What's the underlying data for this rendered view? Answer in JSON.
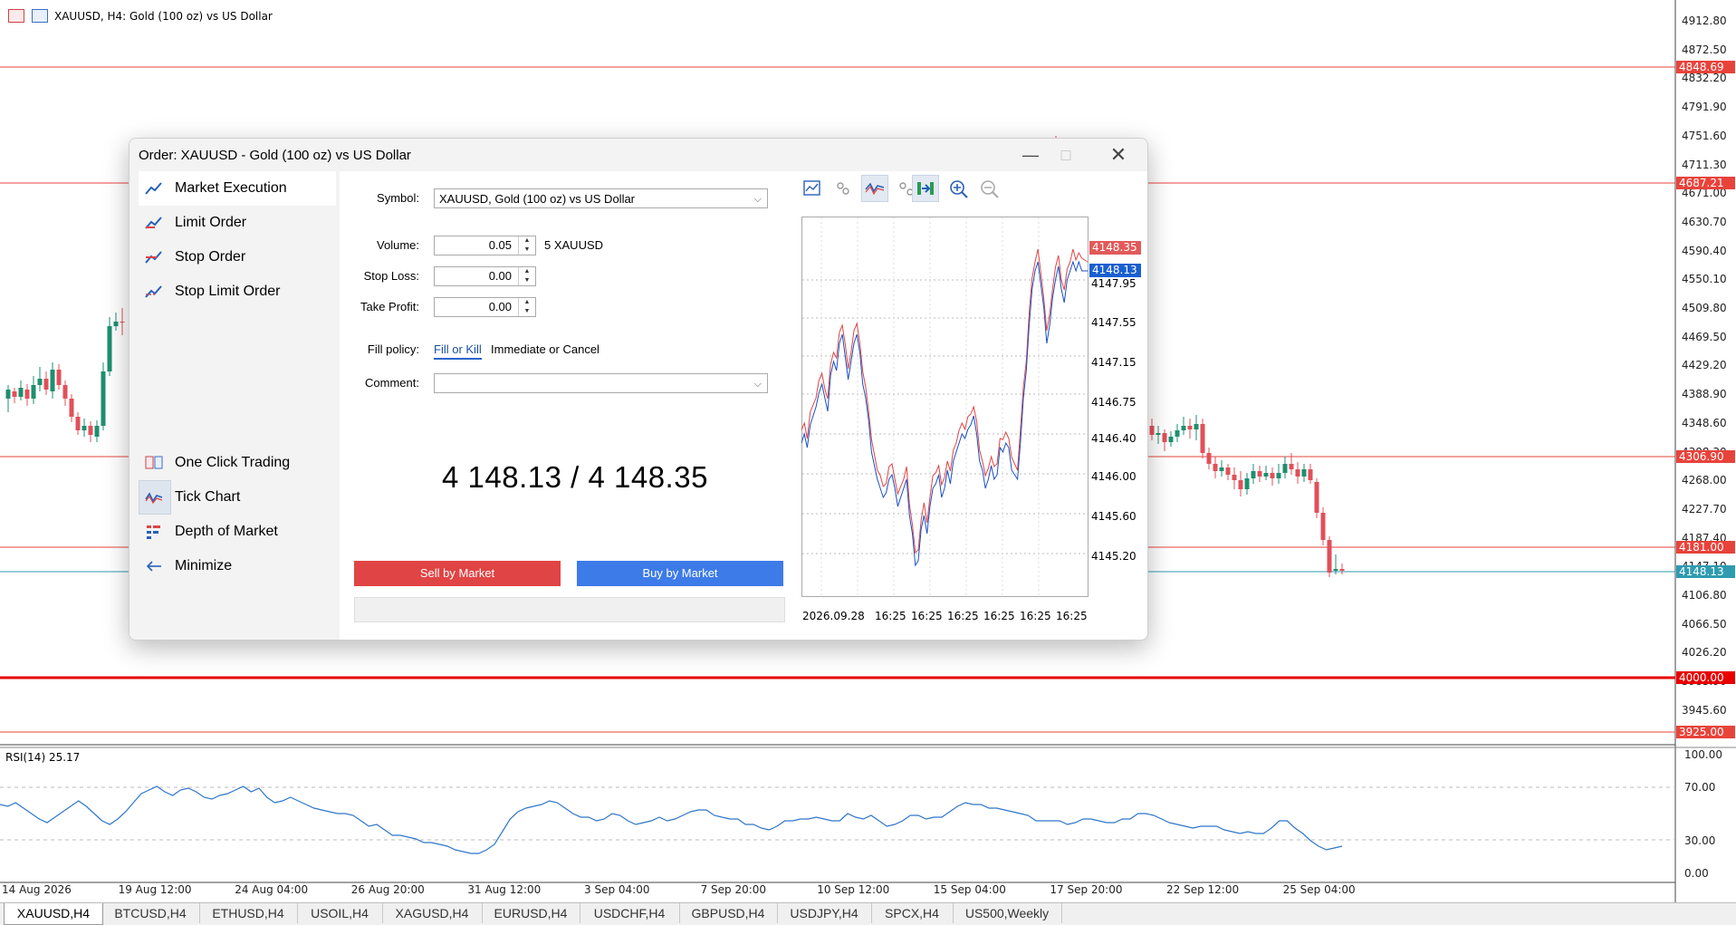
{
  "chart": {
    "title": "XAUUSD, H4:  Gold (100 oz) vs US Dollar",
    "price_ticks": [
      "4912.80",
      "4872.50",
      "4832.20",
      "4791.90",
      "4751.60",
      "4711.30",
      "4671.00",
      "4630.70",
      "4590.40",
      "4550.10",
      "4509.80",
      "4469.50",
      "4429.20",
      "4388.90",
      "4348.60",
      "4308.30",
      "4268.00",
      "4227.70",
      "4187.40",
      "4147.10",
      "4106.80",
      "4066.50",
      "4026.20",
      "3985.90",
      "3945.60"
    ],
    "levels": [
      {
        "price": "4848.69",
        "color": "#e8433b"
      },
      {
        "price": "4687.21",
        "color": "#e8433b"
      },
      {
        "price": "4306.90",
        "color": "#e8433b"
      },
      {
        "price": "4181.00",
        "color": "#e8433b"
      },
      {
        "price": "4148.13",
        "color": "#2e9bb0"
      },
      {
        "price": "4000.00",
        "color": "#e80000"
      },
      {
        "price": "3925.00",
        "color": "#e8433b"
      }
    ],
    "rsi_label": "RSI(14) 25.17",
    "rsi_ticks": [
      "100.00",
      "70.00",
      "30.00",
      "0.00"
    ],
    "time_ticks": [
      "14 Aug 2026",
      "19 Aug 12:00",
      "24 Aug 04:00",
      "26 Aug 20:00",
      "31 Aug 12:00",
      "3 Sep 04:00",
      "7 Sep 20:00",
      "10 Sep 12:00",
      "15 Sep 04:00",
      "17 Sep 20:00",
      "22 Sep 12:00",
      "25 Sep 04:00"
    ],
    "up_color": "#1e8f6f",
    "down_color": "#e0505a"
  },
  "tabs": [
    "XAUUSD,H4",
    "BTCUSD,H4",
    "ETHUSD,H4",
    "USOIL,H4",
    "XAGUSD,H4",
    "EURUSD,H4",
    "USDCHF,H4",
    "GBPUSD,H4",
    "USDJPY,H4",
    "SPCX,H4",
    "US500,Weekly"
  ],
  "dialog": {
    "title": "Order: XAUUSD - Gold (100 oz) vs US Dollar",
    "sidebar": {
      "market_execution": "Market Execution",
      "limit_order": "Limit Order",
      "stop_order": "Stop Order",
      "stop_limit_order": "Stop Limit Order",
      "one_click_trading": "One Click Trading",
      "tick_chart": "Tick Chart",
      "depth_of_market": "Depth of Market",
      "minimize": "Minimize"
    },
    "form": {
      "symbol_label": "Symbol:",
      "symbol_value": "XAUUSD, Gold (100 oz) vs US Dollar",
      "volume_label": "Volume:",
      "volume_value": "0.05",
      "volume_unit": "5 XAUUSD",
      "stop_loss_label": "Stop Loss:",
      "stop_loss_value": "0.00",
      "take_profit_label": "Take Profit:",
      "take_profit_value": "0.00",
      "fill_policy_label": "Fill policy:",
      "fill_policy_options": [
        "Fill or Kill",
        "Immediate or Cancel"
      ],
      "fill_policy_selected": "Fill or Kill",
      "comment_label": "Comment:",
      "comment_value": ""
    },
    "quote": "4 148.13 / 4 148.35",
    "sell_button": "Sell by Market",
    "buy_button": "Buy by Market",
    "sell_color": "#e04444",
    "buy_color": "#3d7be8",
    "tick_chart": {
      "ask_badge": "4148.35",
      "bid_badge": "4148.13",
      "price_labels": [
        "4147.95",
        "4147.55",
        "4147.15",
        "4146.75",
        "4146.40",
        "4146.00",
        "4145.60",
        "4145.20"
      ],
      "time_labels": [
        "2026.09.28",
        "16:25",
        "16:25",
        "16:25",
        "16:25",
        "16:25",
        "16:25"
      ]
    }
  }
}
